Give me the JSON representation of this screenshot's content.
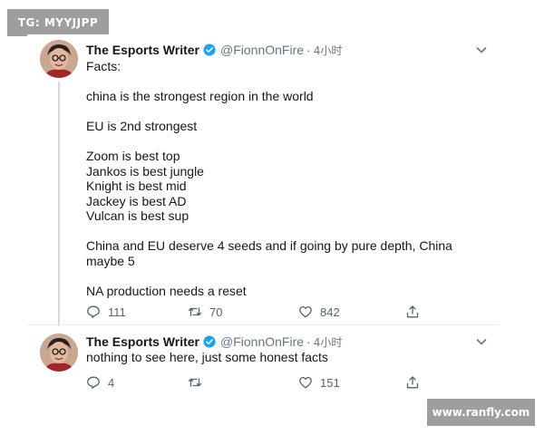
{
  "watermarks": {
    "top_left": "TG: MYYJJPP",
    "bottom_right": "www.ranfly.com"
  },
  "tweets": [
    {
      "author": "The Esports Writer",
      "handle": "@FionnOnFire",
      "separator": "·",
      "time": "4小时",
      "lines": [
        "Facts:",
        "",
        "china is the strongest region in the world",
        "",
        "EU is 2nd strongest",
        "",
        "Zoom is best top",
        "Jankos is best jungle",
        "Knight is best mid",
        "Jackey is best AD",
        "Vulcan is best sup",
        "",
        "China and EU deserve 4 seeds and if going by pure depth, China",
        "maybe 5",
        "",
        "NA production needs a reset"
      ],
      "replies": "111",
      "retweets": "70",
      "likes": "842"
    },
    {
      "author": "The Esports Writer",
      "handle": "@FionnOnFire",
      "separator": "·",
      "time": "4小时",
      "lines": [
        "nothing to see here, just some honest facts"
      ],
      "replies": "4",
      "retweets": "",
      "likes": "151"
    }
  ],
  "colors": {
    "text": "#14171a",
    "secondary": "#657786",
    "verified": "#1da1f2",
    "watermark_bg": "#9e9e9e"
  }
}
